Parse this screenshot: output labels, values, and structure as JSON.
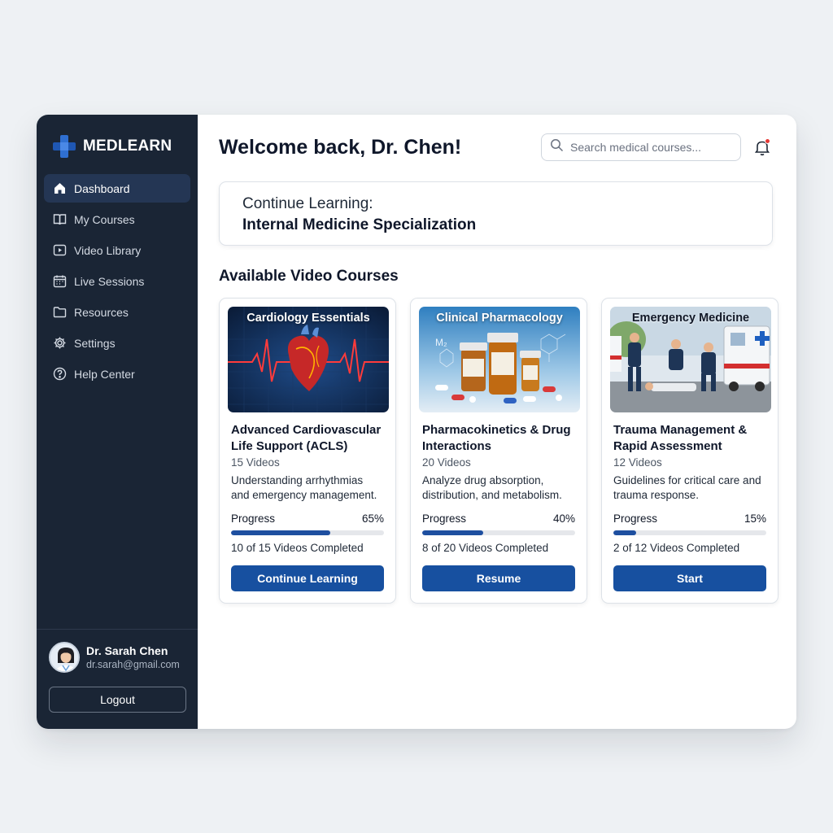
{
  "app": {
    "brand": "MEDLEARN"
  },
  "sidebar": {
    "items": [
      {
        "label": "Dashboard",
        "icon": "home-icon",
        "active": true
      },
      {
        "label": "My Courses",
        "icon": "book-icon",
        "active": false
      },
      {
        "label": "Video Library",
        "icon": "play-icon",
        "active": false
      },
      {
        "label": "Live Sessions",
        "icon": "calendar-icon",
        "active": false
      },
      {
        "label": "Resources",
        "icon": "folder-icon",
        "active": false
      },
      {
        "label": "Settings",
        "icon": "gear-icon",
        "active": false
      },
      {
        "label": "Help Center",
        "icon": "help-icon",
        "active": false
      }
    ],
    "user": {
      "name": "Dr. Sarah Chen",
      "email": "dr.sarah@gmail.com"
    },
    "logout_label": "Logout"
  },
  "header": {
    "welcome": "Welcome back, Dr. Chen!",
    "search_placeholder": "Search medical courses...",
    "notification_dot_color": "#e53935"
  },
  "continue": {
    "label": "Continue Learning:",
    "course": "Internal Medicine Specialization"
  },
  "courses_section": {
    "title": "Available Video Courses",
    "progress_label": "Progress",
    "courses": [
      {
        "thumb_title": "Cardiology Essentials",
        "title": "Advanced Cardiovascular Life Support (ACLS)",
        "count": "15 Videos",
        "description": "Understanding arrhythmias and emergency management.",
        "progress_text": "65%",
        "progress": 0.65,
        "completed": "10 of 15 Videos Completed",
        "button": "Continue Learning"
      },
      {
        "thumb_title": "Clinical Pharmacology",
        "title": "Pharmacokinetics & Drug Interactions",
        "count": "20 Videos",
        "description": "Analyze drug absorption, distribution, and metabolism.",
        "progress_text": "40%",
        "progress": 0.4,
        "completed": "8 of 20 Videos Completed",
        "button": "Resume"
      },
      {
        "thumb_title": "Emergency Medicine",
        "title": "Trauma Management & Rapid Assessment",
        "count": "12 Videos",
        "description": "Guidelines for critical care and trauma response.",
        "progress_text": "15%",
        "progress": 0.15,
        "completed": "2 of 12 Videos Completed",
        "button": "Start"
      }
    ]
  },
  "colors": {
    "sidebar_bg": "#1a2535",
    "active_nav_bg": "#243654",
    "primary_button": "#1750a0",
    "progress_fill": "#1e4fa0"
  }
}
